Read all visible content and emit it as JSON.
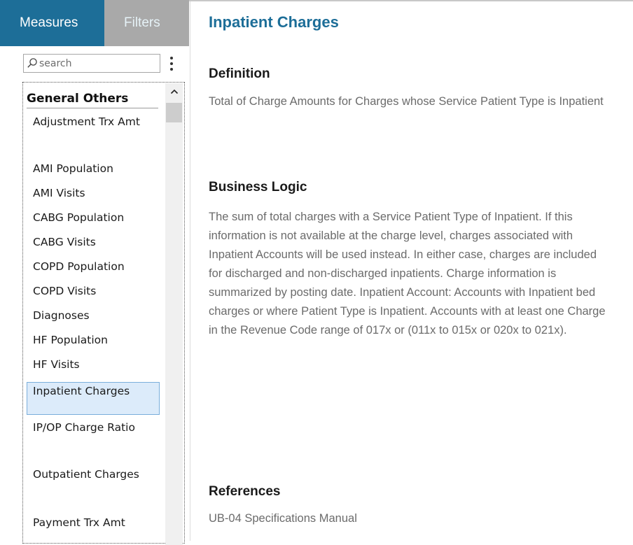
{
  "tabs": {
    "measures": "Measures",
    "filters": "Filters"
  },
  "search": {
    "placeholder": "search",
    "value": ""
  },
  "list": {
    "group": "General Others",
    "items": [
      {
        "label": "Adjustment Trx Amt"
      },
      {
        "label": "AMI Population"
      },
      {
        "label": "AMI Visits"
      },
      {
        "label": "CABG Population"
      },
      {
        "label": "CABG Visits"
      },
      {
        "label": "COPD Population"
      },
      {
        "label": "COPD Visits"
      },
      {
        "label": "Diagnoses"
      },
      {
        "label": "HF Population"
      },
      {
        "label": "HF Visits"
      },
      {
        "label": "Inpatient Charges"
      },
      {
        "label": "IP/OP Charge Ratio"
      },
      {
        "label": "Outpatient Charges"
      },
      {
        "label": "Payment Trx Amt"
      }
    ],
    "selected": "Inpatient Charges"
  },
  "detail": {
    "title": "Inpatient Charges",
    "definition_heading": "Definition",
    "definition": "Total of Charge Amounts for Charges whose Service Patient Type is Inpatient",
    "logic_heading": "Business Logic",
    "logic": "The sum of total charges with a Service Patient Type of Inpatient. If this information is not available at the charge level, charges associated with Inpatient Accounts will be used instead. In either case, charges are included for discharged and non-discharged inpatients. Charge information is summarized by posting date. Inpatient Account: Accounts with Inpatient bed charges or where Patient Type is Inpatient. Accounts with at least one Charge in the Revenue Code range of 017x or (011x to 015x or 020x to 021x).",
    "references_heading": "References",
    "references": "UB-04 Specifications Manual"
  },
  "colors": {
    "accent": "#1d6e98",
    "tab_inactive": "#a9a9a9",
    "selected_bg": "#dcebfa",
    "body_text": "#6b6b6b"
  },
  "icons": {
    "search": "search-icon",
    "menu": "kebab-menu-icon",
    "scroll_up": "chevron-up-icon"
  }
}
